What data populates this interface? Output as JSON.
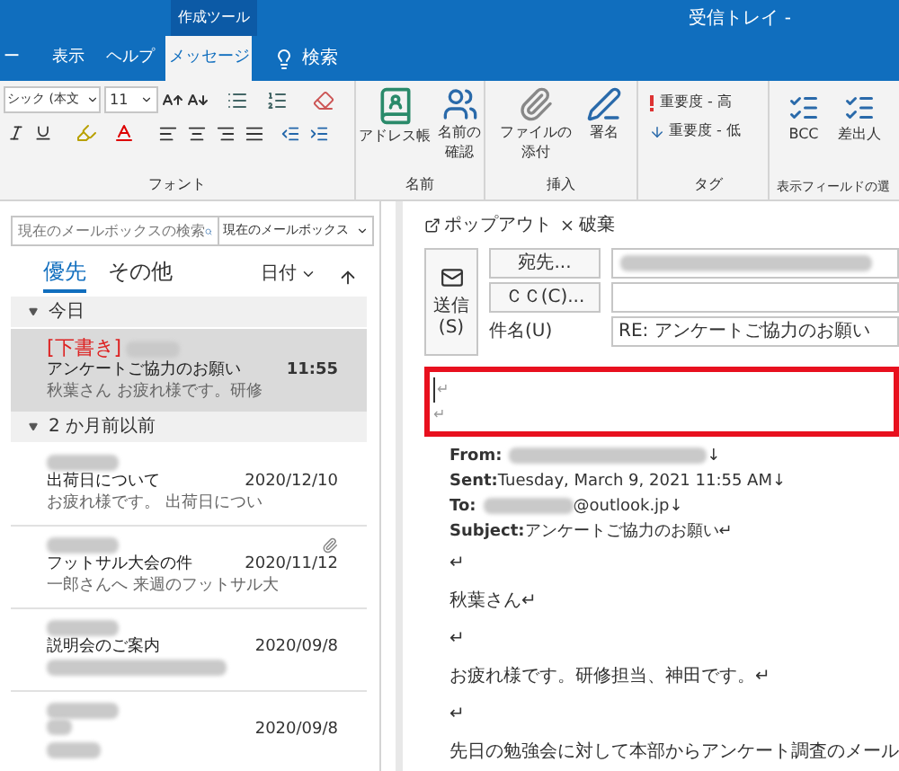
{
  "titlebar": {
    "context_tab": "作成ツール",
    "title": "受信トレイ -"
  },
  "ribbon_tabs": [
    {
      "label": "ー",
      "selected": false
    },
    {
      "label": "表示",
      "selected": false
    },
    {
      "label": "ヘルプ",
      "selected": false
    },
    {
      "label": "メッセージ",
      "selected": true
    }
  ],
  "tell_me": "検索",
  "font_group": {
    "font_name": "シック (本文",
    "font_size": "11",
    "label": "フォント"
  },
  "names_group": {
    "label": "名前",
    "address_book": "アドレス帳",
    "check_names": [
      "名前の",
      "確認"
    ]
  },
  "insert_group": {
    "label": "挿入",
    "attach": [
      "ファイルの",
      "添付"
    ],
    "signature": "署名"
  },
  "tags_group": {
    "label": "タグ",
    "high": "重要度 - 高",
    "low": "重要度 - 低"
  },
  "fields_group": {
    "label": "表示フィールドの選",
    "bcc": "BCC",
    "from": "差出人"
  },
  "search": {
    "placeholder": "現在のメールボックスの検索",
    "scope": "現在のメールボックス"
  },
  "list_tabs": [
    {
      "label": "優先",
      "selected": true
    },
    {
      "label": "その他",
      "selected": false
    }
  ],
  "sort": "日付",
  "mail_groups": [
    {
      "label": "今日",
      "expanded": true,
      "items": [
        {
          "draft": "[下書き]",
          "subject": "アンケートご協力のお願い",
          "date": "11:55",
          "preview": "秋葉さん お疲れ様です。研修",
          "selected": true,
          "attachment": false
        }
      ]
    },
    {
      "label": "2 か月前以前",
      "expanded": true,
      "items": [
        {
          "subject": "出荷日について",
          "date": "2020/12/10",
          "preview": "お疲れ様です。 出荷日につい",
          "selected": false,
          "attachment": false
        },
        {
          "subject": "フットサル大会の件",
          "date": "2020/11/12",
          "preview": "一郎さんへ 来週のフットサル大",
          "selected": false,
          "attachment": true
        },
        {
          "subject": "説明会のご案内",
          "date": "2020/09/8",
          "selected": false,
          "attachment": false
        },
        {
          "date": "2020/09/8",
          "selected": false,
          "attachment": false
        }
      ]
    }
  ],
  "compose": {
    "popout": "ポップアウト",
    "discard": "破棄",
    "send": [
      "送信",
      "(S)"
    ],
    "to_button": "宛先...",
    "cc_button": "ＣＣ(C)...",
    "subject_label": "件名(U)",
    "subject": "RE: アンケートご協力のお願い",
    "body_marks": [
      "↵",
      "↵"
    ],
    "header_lines": [
      {
        "label": "From:",
        "value": "↓",
        "blurred": true
      },
      {
        "label": "Sent:",
        "value": " Tuesday, March 9, 2021 11:55 AM↓",
        "blurred": false
      },
      {
        "label": "To:",
        "value": "@outlook.jp↓",
        "blurred": true
      },
      {
        "label": "Subject:",
        "value": "アンケートご協力のお願い↵",
        "blurred": false
      }
    ],
    "body_lines": [
      "↵",
      "秋葉さん↵",
      "↵",
      "お疲れ様です。研修担当、神田です。↵",
      "↵",
      "先日の勉強会に対して本部からアンケート調査のメール"
    ]
  }
}
